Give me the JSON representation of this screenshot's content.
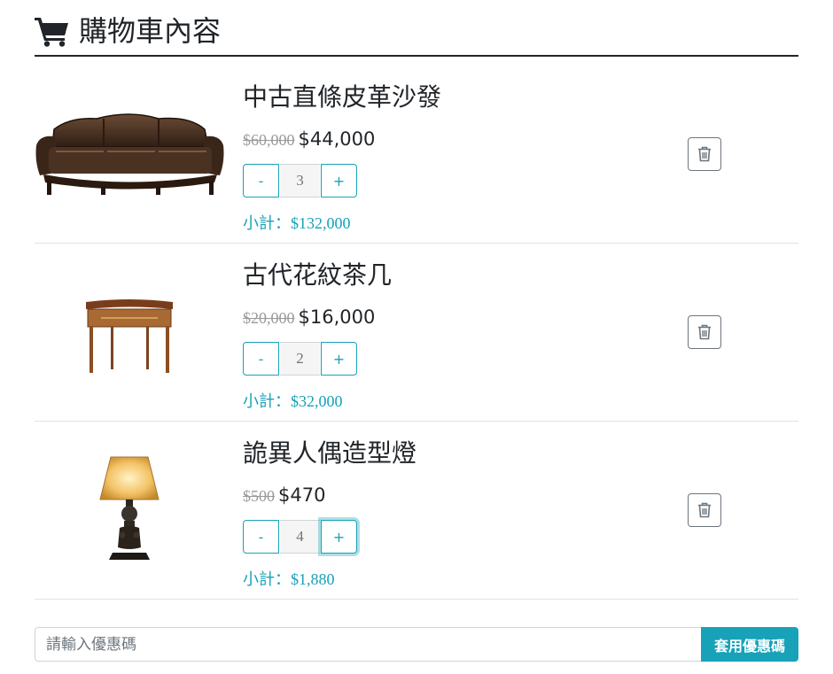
{
  "header": {
    "title": "購物車內容",
    "icon": "shopping-cart-icon"
  },
  "items": [
    {
      "name": "中古直條皮革沙發",
      "original_price": "$60,000",
      "sale_price": "$44,000",
      "quantity": "3",
      "minus_label": "-",
      "plus_label": "+",
      "subtotal": "小計：$132,000",
      "image": "leather-sofa"
    },
    {
      "name": "古代花紋茶几",
      "original_price": "$20,000",
      "sale_price": "$16,000",
      "quantity": "2",
      "minus_label": "-",
      "plus_label": "+",
      "subtotal": "小計：$32,000",
      "image": "console-table"
    },
    {
      "name": "詭異人偶造型燈",
      "original_price": "$500",
      "sale_price": "$470",
      "quantity": "4",
      "minus_label": "-",
      "plus_label": "+",
      "subtotal": "小計：$1,880",
      "image": "figure-lamp"
    }
  ],
  "coupon": {
    "placeholder": "請輸入優惠碼",
    "value": "",
    "button_label": "套用優惠碼"
  },
  "colors": {
    "accent": "#17a2b8",
    "text": "#212529",
    "muted": "#6c757d"
  }
}
